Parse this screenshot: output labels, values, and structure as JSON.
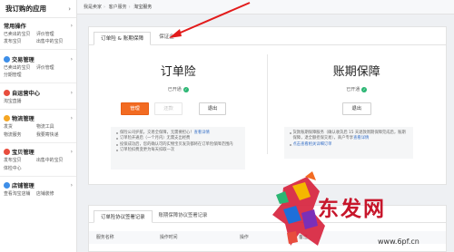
{
  "sidebar": {
    "title": "我订购的应用",
    "sections": [
      {
        "title": "常用操作",
        "icon": "",
        "items": [
          [
            "已卖出的宝贝",
            "评价管理"
          ],
          [
            "发布宝贝",
            "出售中的宝贝"
          ]
        ]
      },
      {
        "title": "交易管理",
        "icon": "trade-icon",
        "color": "#3d8ee8",
        "items": [
          [
            "已卖出的宝贝",
            "评价管理"
          ],
          [
            "分期管理",
            ""
          ]
        ]
      },
      {
        "title": "自运营中心",
        "icon": "operation-icon",
        "color": "#e84d3d",
        "items": [
          [
            "淘宝直播",
            ""
          ]
        ]
      },
      {
        "title": "物流管理",
        "icon": "logistics-icon",
        "color": "#f5a623",
        "items": [
          [
            "发货",
            "物流工具"
          ],
          [
            "物流服务",
            "我要寄快递"
          ]
        ]
      },
      {
        "title": "宝贝管理",
        "icon": "goods-icon",
        "color": "#e84d3d",
        "items": [
          [
            "发布宝贝",
            "出售中的宝贝"
          ],
          [
            "体检中心",
            ""
          ]
        ]
      },
      {
        "title": "店铺管理",
        "icon": "shop-icon",
        "color": "#3d8ee8",
        "items": [
          [
            "查看淘宝店铺",
            "店铺装修"
          ]
        ]
      }
    ]
  },
  "breadcrumb": {
    "items": [
      "我是卖家",
      "客户服务",
      "淘宝服务"
    ]
  },
  "tabs": [
    "订单险 & 账期保障",
    "保证金"
  ],
  "products": {
    "left": {
      "title": "订单险",
      "status": "已开通",
      "buttons": {
        "manage": "管理",
        "withdraw": "还款",
        "exit": "退出"
      },
      "notes": [
        {
          "text": "保险公司护航，交易全保障，无需要担心！",
          "link": "查看详情"
        },
        {
          "text": "订单险开通后（一个月内）无需支出经费",
          "link": ""
        },
        {
          "text": "投保成功后，您的确认可的实物宝贝发货都将在订单险保障范围内",
          "link": ""
        },
        {
          "text": "订单险扣费变更为每天扣取一次",
          "link": ""
        }
      ]
    },
    "right": {
      "title": "账期保障",
      "status": "已开通",
      "buttons": {
        "exit": "退出"
      },
      "notes": [
        {
          "text": "货款账期保障服务（确认收货后 15 天退款周期保障完成后，账期保障，退全额担保交易），商户专享",
          "link": "查看详情"
        },
        {
          "text": "点击查看相关详细订单",
          "link": ""
        }
      ]
    }
  },
  "records": {
    "tabs": [
      "订单险协议签署记录",
      "账期保障协议签署记录"
    ],
    "columns": [
      "服务名称",
      "操作时间",
      "操作",
      "备注"
    ]
  },
  "watermark": {
    "text": "东发网",
    "url": "www.6pf.cn"
  },
  "colors": {
    "accent": "#f26b22",
    "link": "#3a72c8",
    "success": "#2bb673",
    "annotation": "#e21b1b"
  }
}
